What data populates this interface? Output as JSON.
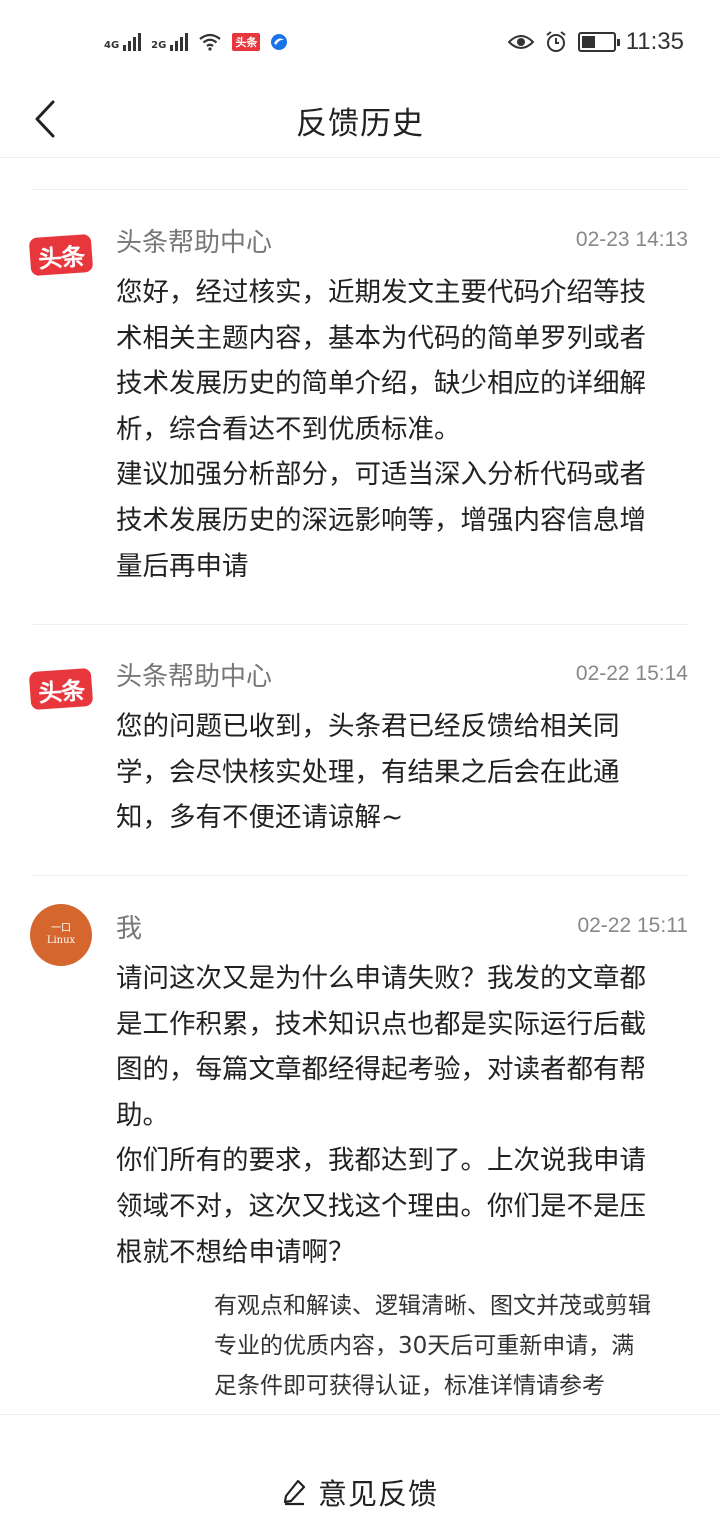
{
  "status_bar": {
    "sim1_label": "4G",
    "sim2_label": "2G",
    "toutiao_badge": "头条",
    "time": "11:35",
    "icons": [
      "eye-icon",
      "alarm-icon",
      "battery-icon"
    ]
  },
  "nav": {
    "back_icon": "chevron-left-icon",
    "title": "反馈历史"
  },
  "messages": [
    {
      "sender": "头条帮助中心",
      "time": "02-23 14:13",
      "avatar": "toutiao-logo",
      "avatar_text": "头条",
      "paragraphs": [
        "您好，经过核实，近期发文主要代码介绍等技术相关主题内容，基本为代码的简单罗列或者技术发展历史的简单介绍，缺少相应的详细解析，综合看达不到优质标准。",
        "建议加强分析部分，可适当深入分析代码或者技术发展历史的深远影响等，增强内容信息增量后再申请"
      ]
    },
    {
      "sender": "头条帮助中心",
      "time": "02-22 15:14",
      "avatar": "toutiao-logo",
      "avatar_text": "头条",
      "paragraphs": [
        "您的问题已收到，头条君已经反馈给相关同学，会尽快核实处理，有结果之后会在此通知，多有不便还请谅解~"
      ]
    },
    {
      "sender": "我",
      "time": "02-22 15:11",
      "avatar": "user-avatar",
      "avatar_text_line1": "一口",
      "avatar_text_line2": "Linux",
      "paragraphs": [
        "请问这次又是为什么申请失败？我发的文章都是工作积累，技术知识点也都是实际运行后截图的，每篇文章都经得起考验，对读者都有帮助。",
        "你们所有的要求，我都达到了。上次说我申请领域不对，这次又找这个理由。你们是不是压根就不想给申请啊？"
      ],
      "note": "有观点和解读、逻辑清晰、图文并茂或剪辑专业的优质内容，30天后可重新申请，满足条件即可获得认证，标准详情请参考"
    }
  ],
  "bottom": {
    "icon": "pen-icon",
    "label": "意见反馈"
  },
  "colors": {
    "brand_red": "#e8373c",
    "user_avatar": "#d4662e"
  }
}
